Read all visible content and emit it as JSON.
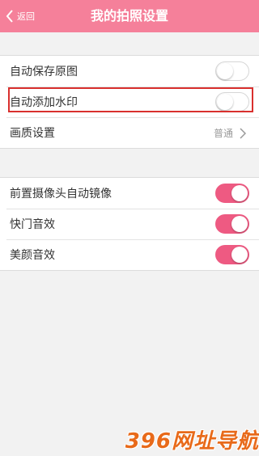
{
  "header": {
    "back_label": "返回",
    "title": "我的拍照设置",
    "color": "#f5809a"
  },
  "group1": [
    {
      "label": "自动保存原图",
      "control": "toggle",
      "on": false
    },
    {
      "label": "自动添加水印",
      "control": "toggle",
      "on": false,
      "highlighted": true
    },
    {
      "label": "画质设置",
      "control": "select",
      "value": "普通"
    }
  ],
  "group2": [
    {
      "label": "前置摄像头自动镜像",
      "control": "toggle",
      "on": true
    },
    {
      "label": "快门音效",
      "control": "toggle",
      "on": true
    },
    {
      "label": "美颜音效",
      "control": "toggle",
      "on": true
    }
  ],
  "accent_color": "#ee5a82",
  "highlight_color": "#d9302e",
  "watermark": {
    "text": "396网址导航",
    "color": "#e86a1a"
  }
}
